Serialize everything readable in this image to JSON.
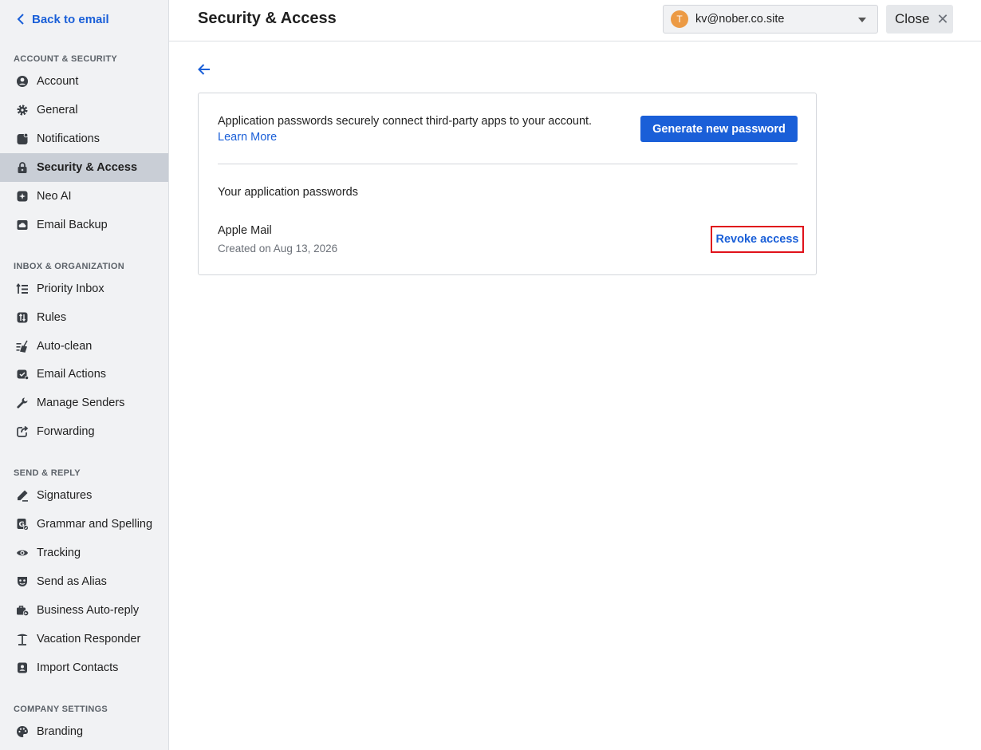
{
  "sidebar": {
    "back_label": "Back to email",
    "sections": [
      {
        "title": "ACCOUNT & SECURITY"
      },
      {
        "title": "INBOX & ORGANIZATION"
      },
      {
        "title": "SEND & REPLY"
      },
      {
        "title": "COMPANY SETTINGS"
      }
    ],
    "items": [
      {
        "label": "Account",
        "icon": "account-icon"
      },
      {
        "label": "General",
        "icon": "gear-icon"
      },
      {
        "label": "Notifications",
        "icon": "notifications-icon"
      },
      {
        "label": "Security & Access",
        "icon": "lock-icon",
        "active": true
      },
      {
        "label": "Neo AI",
        "icon": "sparkle-icon"
      },
      {
        "label": "Email Backup",
        "icon": "cloud-backup-icon"
      },
      {
        "label": "Priority Inbox",
        "icon": "priority-icon"
      },
      {
        "label": "Rules",
        "icon": "rules-icon"
      },
      {
        "label": "Auto-clean",
        "icon": "broom-icon"
      },
      {
        "label": "Email Actions",
        "icon": "email-actions-icon"
      },
      {
        "label": "Manage Senders",
        "icon": "wrench-icon"
      },
      {
        "label": "Forwarding",
        "icon": "forward-icon"
      },
      {
        "label": "Signatures",
        "icon": "pen-icon"
      },
      {
        "label": "Grammar and Spelling",
        "icon": "grammar-icon"
      },
      {
        "label": "Tracking",
        "icon": "eye-icon"
      },
      {
        "label": "Send as Alias",
        "icon": "mask-icon"
      },
      {
        "label": "Business Auto-reply",
        "icon": "briefcase-reply-icon"
      },
      {
        "label": "Vacation Responder",
        "icon": "palm-tree-icon"
      },
      {
        "label": "Import Contacts",
        "icon": "contacts-icon"
      },
      {
        "label": "Branding",
        "icon": "palette-icon"
      }
    ]
  },
  "header": {
    "title": "Security & Access",
    "account": {
      "initial": "T",
      "email": "kv@nober.co.site"
    },
    "close_label": "Close"
  },
  "card": {
    "description": "Application passwords securely connect third-party apps to your account.",
    "learn_more": "Learn More",
    "generate_button": "Generate new password",
    "list_title": "Your application passwords",
    "passwords": [
      {
        "name": "Apple Mail",
        "created": "Created on Aug 13, 2026",
        "action": "Revoke access"
      }
    ]
  },
  "colors": {
    "accent": "#1a5fd8",
    "highlight": "#e0121b",
    "avatar": "#ec9a44"
  }
}
